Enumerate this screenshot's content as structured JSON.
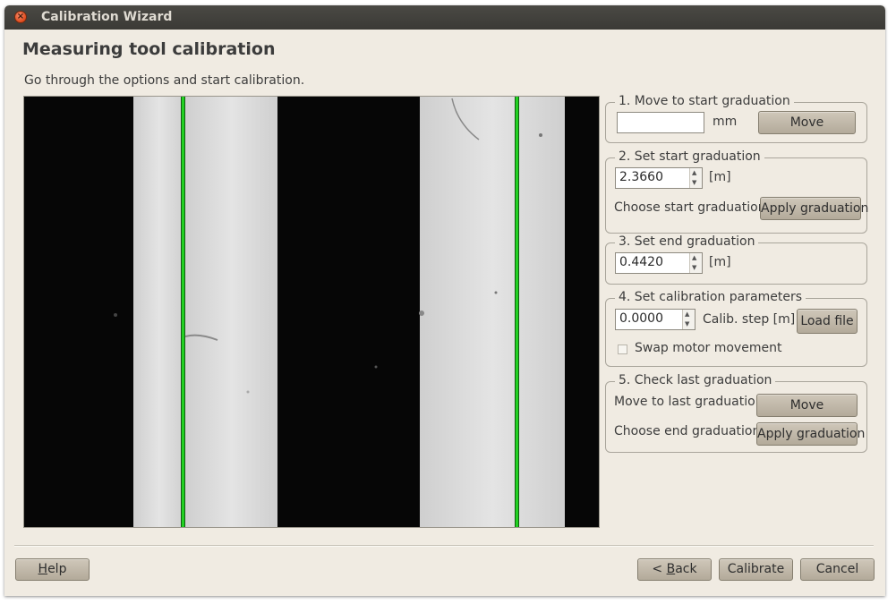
{
  "window": {
    "title": "Calibration Wizard"
  },
  "page": {
    "title": "Measuring tool calibration",
    "subtitle": "Go through the options and start calibration."
  },
  "groups": {
    "move_start": {
      "title": "1. Move to start graduation",
      "input_value": "",
      "unit": "mm",
      "button": "Move"
    },
    "set_start": {
      "title": "2. Set start graduation",
      "value": "2.3660",
      "unit": "[m]",
      "choose_label": "Choose start graduation",
      "button": "Apply graduation"
    },
    "set_end": {
      "title": "3. Set end graduation",
      "value": "0.4420",
      "unit": "[m]"
    },
    "params": {
      "title": "4. Set calibration parameters",
      "value": "0.0000",
      "step_label": "Calib. step [m]",
      "load_button": "Load file",
      "swap_label": "Swap motor movement",
      "swap_checked": false
    },
    "check_last": {
      "title": "5. Check last graduation",
      "move_label": "Move to last graduation",
      "move_button": "Move",
      "choose_label": "Choose end graduation",
      "apply_button": "Apply graduation"
    }
  },
  "footer": {
    "help_first": "H",
    "help_rest": "elp",
    "back_prefix": "< ",
    "back_first": "B",
    "back_rest": "ack",
    "calibrate": "Calibrate",
    "cancel": "Cancel"
  },
  "colors": {
    "marker": "#22d022",
    "window_bg": "#f0ebe2",
    "titlebar": "#3d3c38"
  }
}
